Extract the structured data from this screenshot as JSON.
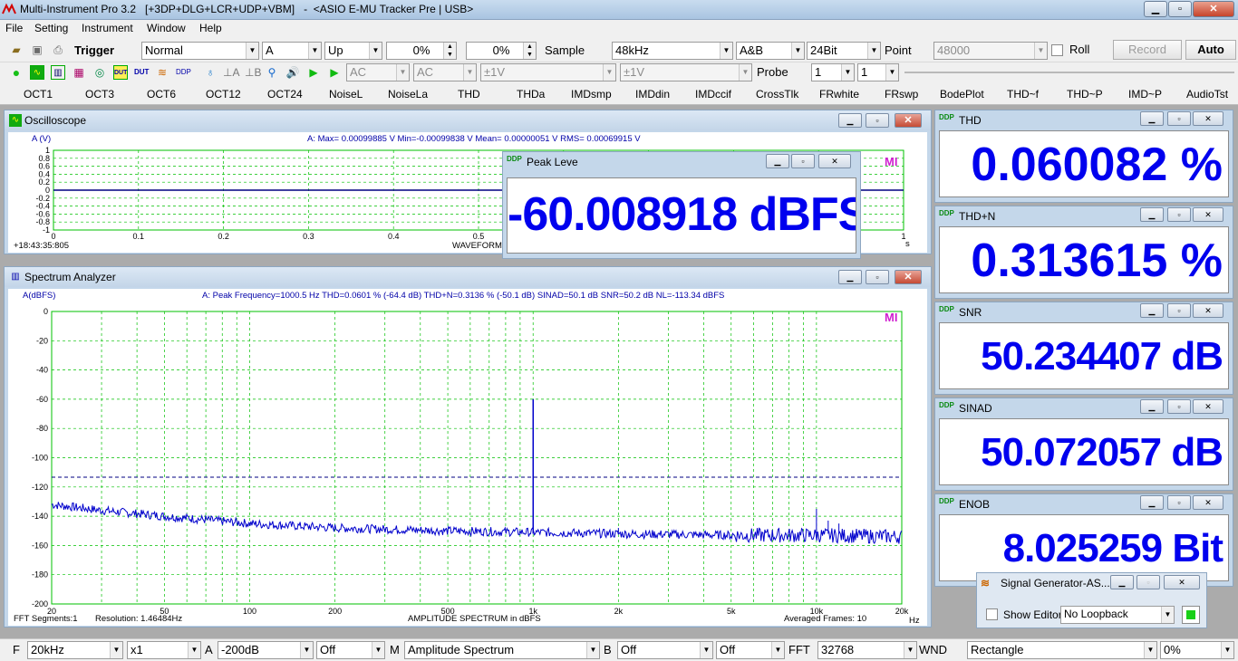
{
  "app": {
    "title": "Multi-Instrument Pro 3.2",
    "title_extra": "   [+3DP+DLG+LCR+UDP+VBM]   -  <ASIO E-MU Tracker Pre | USB>"
  },
  "menu": [
    "File",
    "Setting",
    "Instrument",
    "Window",
    "Help"
  ],
  "toolbar1": {
    "trigger_label": "Trigger",
    "trigger_mode": "Normal",
    "trigger_channel": "A",
    "trigger_edge": "Up",
    "level1": "0%",
    "level2": "0%",
    "sample_label": "Sample",
    "sample_rate": "48kHz",
    "channels": "A&B",
    "bits": "24Bit",
    "point_label": "Point",
    "points": "48000",
    "roll_label": "Roll",
    "record_label": "Record",
    "auto_label": "Auto"
  },
  "toolbar2": {
    "coupling_a": "AC",
    "coupling_b": "AC",
    "range_a": "±1V",
    "range_b": "±1V",
    "probe_label": "Probe",
    "probe_a": "1",
    "probe_b": "1"
  },
  "toolbar3": [
    "OCT1",
    "OCT3",
    "OCT6",
    "OCT12",
    "OCT24",
    "NoiseL",
    "NoiseLa",
    "THD",
    "THDa",
    "IMDsmp",
    "IMDdin",
    "IMDccif",
    "CrossTlk",
    "FRwhite",
    "FRswp",
    "BodePlot",
    "THD~f",
    "THD~P",
    "IMD~P",
    "AudioTst"
  ],
  "oscilloscope": {
    "title": "Oscilloscope",
    "ylabel": "A (V)",
    "stats": "A: Max= 0.00099885 V  Min=-0.00099838 V  Mean= 0.00000051 V  RMS= 0.00069915 V",
    "yticks": [
      "1",
      "0.8",
      "0.6",
      "0.4",
      "0.2",
      "0",
      "-0.2",
      "-0.4",
      "-0.6",
      "-0.8",
      "-1"
    ],
    "xticks": [
      "0",
      "0.1",
      "0.2",
      "0.3",
      "0.4",
      "0.5",
      "1"
    ],
    "timestamp": "+18:43:35:805",
    "mode": "WAVEFORM",
    "xunit": "s",
    "logo": "MI"
  },
  "peak": {
    "title": "Peak Leve",
    "value": "-60.008918 dBFS"
  },
  "spectrum": {
    "title": "Spectrum Analyzer",
    "ylabel": "A(dBFS)",
    "stats": "A: Peak Frequency=1000.5 Hz  THD=0.0601 % (-64.4 dB)  THD+N=0.3136 % (-50.1 dB)  SINAD=50.1 dB  SNR=50.2 dB  NL=-113.34 dBFS",
    "yticks": [
      "0",
      "-20",
      "-40",
      "-60",
      "-80",
      "-100",
      "-120",
      "-140",
      "-160",
      "-180",
      "-200"
    ],
    "xticks": [
      "20",
      "50",
      "100",
      "200",
      "500",
      "1k",
      "2k",
      "5k",
      "10k",
      "20k"
    ],
    "xunit": "Hz",
    "fft_segments": "FFT  Segments:1",
    "resolution": "Resolution:  1.46484Hz",
    "mode": "AMPLITUDE SPECTRUM in dBFS",
    "averaged": "Averaged Frames:  10",
    "logo": "MI"
  },
  "meters": [
    {
      "name": "THD",
      "value": "0.060082 %"
    },
    {
      "name": "THD+N",
      "value": "0.313615 %"
    },
    {
      "name": "SNR",
      "value": "50.234407 dB"
    },
    {
      "name": "SINAD",
      "value": "50.072057 dB"
    },
    {
      "name": "ENOB",
      "value": "8.025259 Bit"
    }
  ],
  "siggen": {
    "title": "Signal Generator-AS...",
    "show_editor": "Show Editor",
    "loopback": "No Loopback"
  },
  "statusbar": {
    "f_label": "F",
    "freq_range": "20kHz",
    "zoom": "x1",
    "a_label": "A",
    "a_min": "-200dB",
    "a_off": "Off",
    "m_label": "M",
    "mode": "Amplitude Spectrum",
    "b_label": "B",
    "b_off": "Off",
    "b_off2": "Off",
    "fft_label": "FFT",
    "fft_size": "32768",
    "wnd_label": "WND",
    "window": "Rectangle",
    "overlap": "0%"
  },
  "chart_data": [
    {
      "type": "line",
      "title": "Oscilloscope",
      "ylabel": "A (V)",
      "xlabel": "",
      "x_unit": "s",
      "xlim": [
        0,
        1
      ],
      "ylim": [
        -1,
        1
      ],
      "series": [
        {
          "values_note": "",
          "values": [
            0,
            0,
            0,
            0,
            0,
            0,
            0,
            0,
            0,
            0,
            0
          ]
        }
      ],
      "x": [
        0,
        0.1,
        0.2,
        0.3,
        0.4,
        0.5,
        0.6,
        0.7,
        0.8,
        0.9,
        1.0
      ]
    },
    {
      "type": "line",
      "title": "Spectrum Analyzer",
      "ylabel": "A(dBFS)",
      "xlabel": "",
      "x_unit": "Hz",
      "x_scale": "log",
      "xlim": [
        20,
        20000
      ],
      "ylim": [
        -200,
        0
      ],
      "noise_level_dbfs": -113.34,
      "peak": {
        "x": 1000.5,
        "y": -60
      },
      "x": [
        20,
        30,
        50,
        100,
        200,
        500,
        1000,
        2000,
        5000,
        10000,
        20000
      ],
      "series": [
        {
          "values": [
            -132,
            -136,
            -140,
            -145,
            -148,
            -150,
            -151,
            -152,
            -153,
            -153,
            -154
          ]
        }
      ],
      "harmonics": [
        {
          "x": 2000,
          "y": -148
        },
        {
          "x": 10000,
          "y": -135
        },
        {
          "x": 11000,
          "y": -143
        },
        {
          "x": 12000,
          "y": -145
        }
      ]
    }
  ]
}
